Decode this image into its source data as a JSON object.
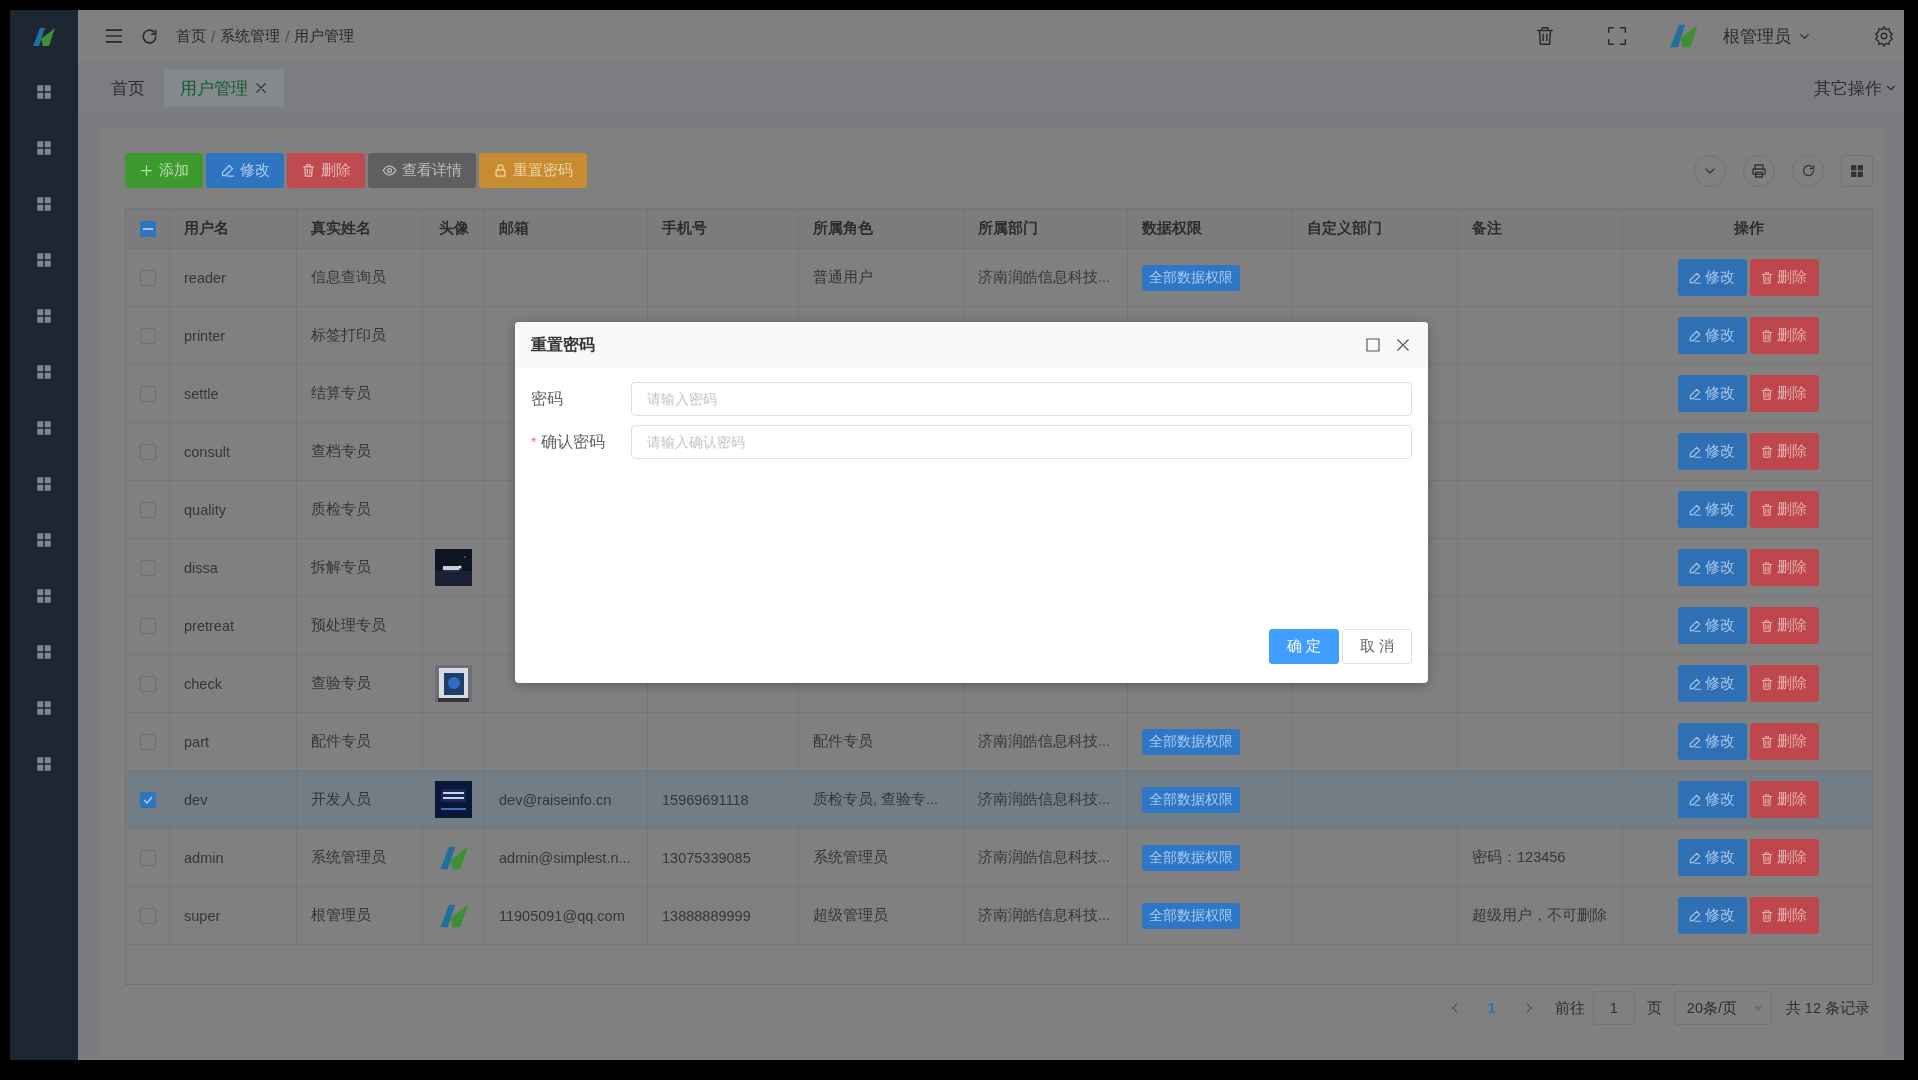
{
  "header": {
    "breadcrumb": [
      "首页",
      "系统管理",
      "用户管理"
    ],
    "breadcrumb_separator": "/",
    "user": "根管理员"
  },
  "tabs": [
    {
      "label": "首页",
      "selected": false,
      "closable": false
    },
    {
      "label": "用户管理",
      "selected": true,
      "closable": true
    }
  ],
  "tab_menu": "其它操作",
  "toolbar": [
    {
      "label": "添加",
      "kind": "add"
    },
    {
      "label": "修改",
      "kind": "edit"
    },
    {
      "label": "删除",
      "kind": "delete"
    },
    {
      "label": "查看详情",
      "kind": "view"
    },
    {
      "label": "重置密码",
      "kind": "reset"
    }
  ],
  "table": {
    "header_checkbox": {
      "indeterminate": true
    },
    "columns": [
      "用户名",
      "真实姓名",
      "头像",
      "邮箱",
      "手机号",
      "所属角色",
      "所属部门",
      "数据权限",
      "自定义部门",
      "备注",
      "操作"
    ],
    "rows": [
      {
        "selected": false,
        "username": "reader",
        "real_name": "信息查询员",
        "role": "普通用户",
        "department": "济南润皓信息科技...",
        "permission": "全部数据权限",
        "actions": [
          "修改",
          "删除"
        ]
      },
      {
        "selected": false,
        "username": "printer",
        "real_name": "标签打印员",
        "actions": [
          "修改",
          "删除"
        ]
      },
      {
        "selected": false,
        "username": "settle",
        "real_name": "结算专员",
        "actions": [
          "修改",
          "删除"
        ]
      },
      {
        "selected": false,
        "username": "consult",
        "real_name": "查档专员",
        "actions": [
          "修改",
          "删除"
        ]
      },
      {
        "selected": false,
        "username": "quality",
        "real_name": "质检专员",
        "actions": [
          "修改",
          "删除"
        ]
      },
      {
        "selected": false,
        "username": "dissa",
        "real_name": "拆解专员",
        "avatar": {
          "kind": "picture"
        },
        "actions": [
          "修改",
          "删除"
        ]
      },
      {
        "selected": false,
        "username": "pretreat",
        "real_name": "预处理专员",
        "actions": [
          "修改",
          "删除"
        ]
      },
      {
        "selected": false,
        "username": "check",
        "real_name": "查验专员",
        "avatar": {
          "kind": "picture"
        },
        "actions": [
          "修改",
          "删除"
        ]
      },
      {
        "selected": false,
        "username": "part",
        "real_name": "配件专员",
        "role": "配件专员",
        "department": "济南润皓信息科技...",
        "permission": "全部数据权限",
        "actions": [
          "修改",
          "删除"
        ]
      },
      {
        "selected": true,
        "username": "dev",
        "real_name": "开发人员",
        "avatar": {
          "kind": "picture"
        },
        "email": "dev@raiseinfo.cn",
        "mobile": "15969691118",
        "role": "质检专员, 查验专...",
        "department": "济南润皓信息科技...",
        "permission": "全部数据权限",
        "actions": [
          "修改",
          "删除"
        ]
      },
      {
        "selected": false,
        "username": "admin",
        "real_name": "系统管理员",
        "avatar": {
          "kind": "logo"
        },
        "email": "admin@simplest.n...",
        "mobile": "13075339085",
        "role": "系统管理员",
        "department": "济南润皓信息科技...",
        "permission": "全部数据权限",
        "remark": "密码：123456",
        "actions": [
          "修改",
          "删除"
        ]
      },
      {
        "selected": false,
        "username": "super",
        "real_name": "根管理员",
        "avatar": {
          "kind": "logo"
        },
        "email": "11905091@qq.com",
        "mobile": "13888889999",
        "role": "超级管理员",
        "department": "济南润皓信息科技...",
        "permission": "全部数据权限",
        "remark": "超级用户，不可删除",
        "actions": [
          "修改",
          "删除"
        ]
      }
    ]
  },
  "pagination": {
    "pages": [
      {
        "label": "1",
        "selected": true
      }
    ],
    "goto_label": "前往",
    "goto_value": "1",
    "page_unit": "页",
    "page_size": "20条/页",
    "total": "共 12 条记录"
  },
  "dialog": {
    "title": "重置密码",
    "required_mark": "*",
    "fields": [
      {
        "label": "密码",
        "placeholder": "请输入密码",
        "required": false
      },
      {
        "label": "确认密码",
        "placeholder": "请输入确认密码",
        "required": true
      }
    ],
    "buttons": [
      {
        "label": "确定",
        "kind": "primary"
      },
      {
        "label": "取消",
        "kind": "default"
      }
    ]
  }
}
